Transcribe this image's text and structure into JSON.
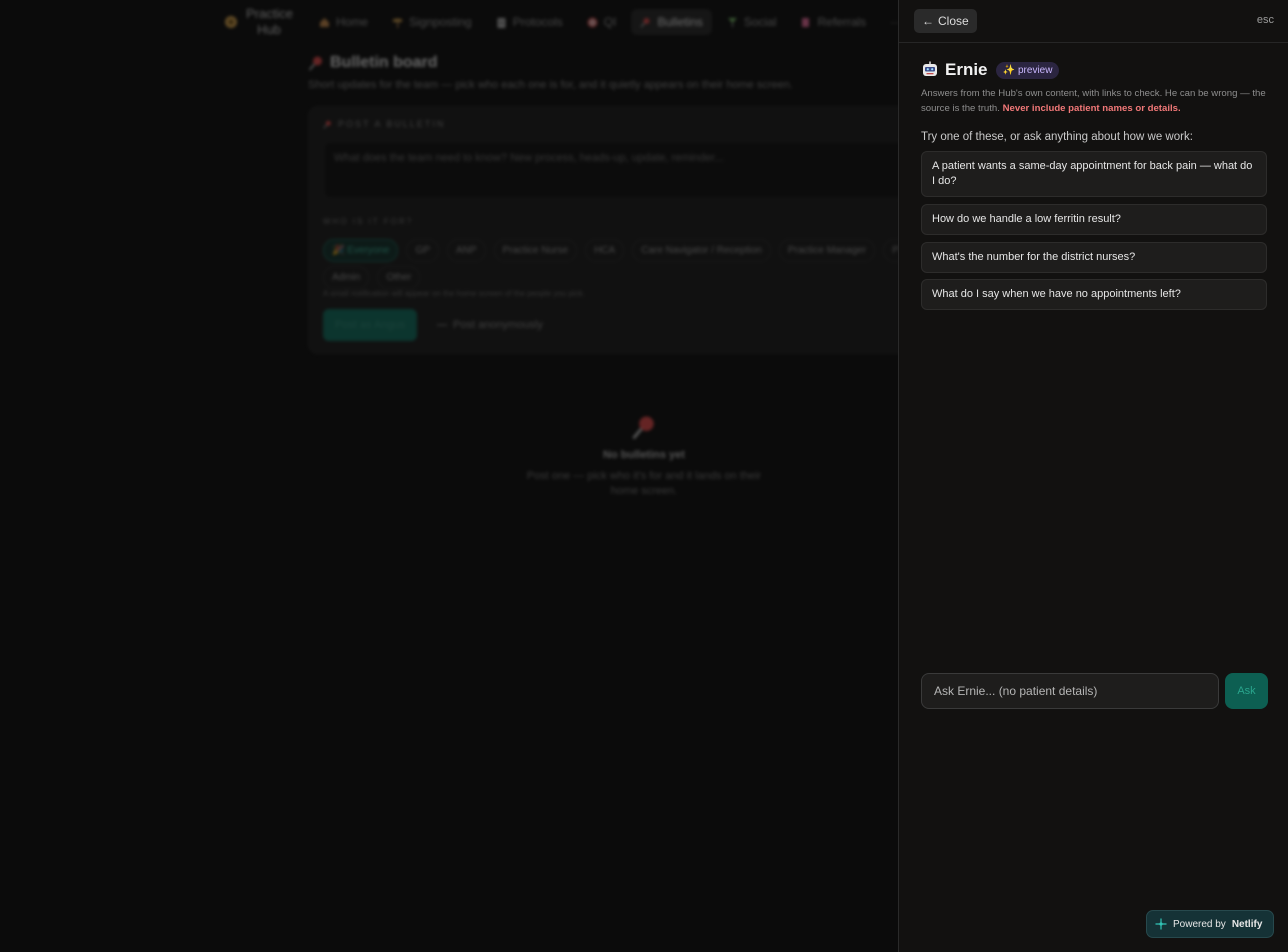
{
  "background": {
    "nav": {
      "brand": "Practice Hub",
      "brand_line1": "Practice",
      "brand_line2": "Hub",
      "items": [
        {
          "label": "Home",
          "icon": "house-icon"
        },
        {
          "label": "Signposting",
          "icon": "signpost-icon"
        },
        {
          "label": "Protocols",
          "icon": "clipboard-icon"
        },
        {
          "label": "QI",
          "icon": "target-icon"
        },
        {
          "label": "Bulletins",
          "icon": "pushpin-icon",
          "active": true
        },
        {
          "label": "Social",
          "icon": "drink-icon"
        },
        {
          "label": "Referrals",
          "icon": "paper-icon"
        }
      ],
      "more": "···"
    },
    "board": {
      "title": "Bulletin board",
      "subtitle": "Short updates for the team — pick who each one is for, and it quietly appears on their home screen."
    },
    "post": {
      "label": "POST A BULLETIN",
      "placeholder": "What does the team need to know? New process, heads-up, update, reminder...",
      "who_label": "WHO IS IT FOR?",
      "audiences_row1": [
        "Everyone",
        "GP",
        "ANP",
        "Practice Nurse",
        "HCA",
        "Care Navigator / Reception",
        "Practice Manager",
        "Pharmacist"
      ],
      "audiences_row2": [
        "Admin",
        "Other"
      ],
      "selected_audience": "Everyone",
      "notify_note": "A small notification will appear on the home screen of the people you pick.",
      "post_button": "Post as Angus",
      "anon_label": "Post anonymously"
    },
    "empty": {
      "title": "No bulletins yet",
      "subtitle": "Post one — pick who it's for and it lands on their home screen."
    }
  },
  "panel": {
    "close_label": "Close",
    "esc_hint": "esc",
    "assistant_name": "Ernie",
    "badge": "preview",
    "disclaimer": "Answers from the Hub's own content, with links to check. He can be wrong — the source is the truth.",
    "warning": "Never include patient names or details.",
    "try_label": "Try one of these, or ask anything about how we work:",
    "suggestions": [
      "A patient wants a same-day appointment for back pain — what do I do?",
      "How do we handle a low ferritin result?",
      "What's the number for the district nurses?",
      "What do I say when we have no appointments left?"
    ],
    "input_placeholder": "Ask Ernie... (no patient details)",
    "ask_label": "Ask"
  },
  "footer": {
    "powered_by": "Powered by",
    "brand": "Netlify"
  },
  "colors": {
    "accent": "#0d5f52",
    "warning": "#f17878",
    "badge_bg": "#2b2540"
  }
}
